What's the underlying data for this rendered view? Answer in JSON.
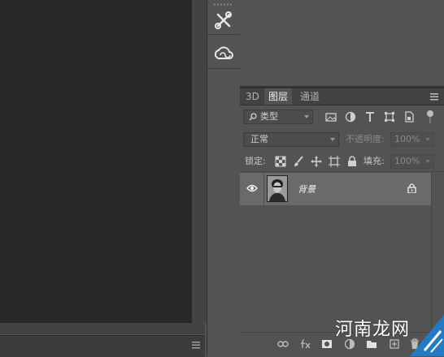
{
  "panel_tabs": {
    "tab_3d": "3D",
    "tab_layers": "图层",
    "tab_channels": "通道"
  },
  "filter": {
    "kind_label": "类型"
  },
  "blend": {
    "mode": "正常",
    "opacity_label": "不透明度:",
    "opacity_value": "100%"
  },
  "lock": {
    "label": "锁定:",
    "fill_label": "填充:",
    "fill_value": "100%"
  },
  "layers": [
    {
      "name": "背景",
      "visible": true,
      "locked": true
    }
  ],
  "watermark": {
    "text": "河南龙网"
  },
  "colors": {
    "canvas_bg": "#282828",
    "panel_bg": "#535353",
    "tabbar_bg": "#424242",
    "selected_layer_bg": "#6a6a6a",
    "watermark_blue": "#1f7fd1"
  },
  "icons": {
    "strip": [
      "tools-presets-icon",
      "creative-cloud-icon"
    ],
    "filter": [
      "image-filter-icon",
      "adjustment-filter-icon",
      "type-filter-icon",
      "shape-filter-icon",
      "smart-object-filter-icon",
      "filter-toggle-icon"
    ],
    "lock": [
      "lock-transparent-pixels-icon",
      "lock-image-pixels-icon",
      "lock-position-icon",
      "lock-artboard-icon",
      "lock-all-icon"
    ],
    "bottom": [
      "link-layers-icon",
      "fx-icon",
      "add-mask-icon",
      "adjustment-layer-icon",
      "new-group-icon",
      "new-layer-icon",
      "delete-layer-icon"
    ]
  }
}
